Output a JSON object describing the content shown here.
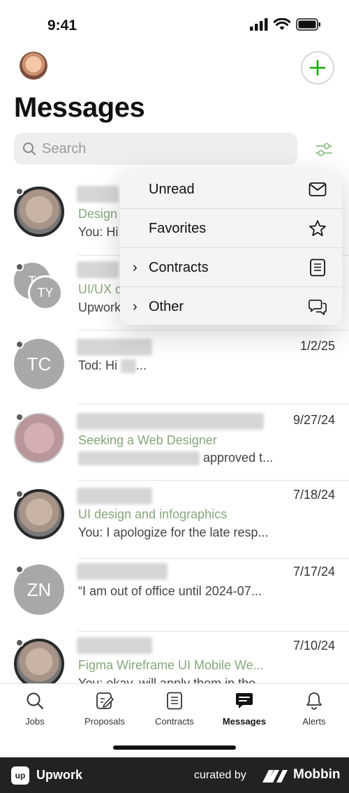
{
  "status": {
    "time": "9:41"
  },
  "header": {
    "title": "Messages"
  },
  "search": {
    "placeholder": "Search"
  },
  "dropdown": {
    "items": [
      {
        "label": "Unread",
        "icon": "envelope-icon"
      },
      {
        "label": "Favorites",
        "icon": "star-icon"
      },
      {
        "label": "Contracts",
        "icon": "document-icon"
      },
      {
        "label": "Other",
        "icon": "chat-bubbles-icon"
      }
    ]
  },
  "messages": [
    {
      "subject": "Design",
      "preview": "You: Hi"
    },
    {
      "initials_a": "T",
      "initials_b": "TY",
      "subject": "UI/UX d",
      "preview": "Upwork"
    },
    {
      "initials": "TC",
      "date": "1/2/25",
      "preview_prefix": "Tod: Hi",
      "preview_suffix": "..."
    },
    {
      "date": "9/27/24",
      "subject": "Seeking a Web Designer",
      "preview_suffix": "approved t..."
    },
    {
      "date": "7/18/24",
      "subject": "UI design and infographics",
      "preview": "You: I apologize for the late resp..."
    },
    {
      "initials": "ZN",
      "date": "7/17/24",
      "preview": "“I am out of office until 2024-07..."
    },
    {
      "date": "7/10/24",
      "subject": "Figma Wireframe UI Mobile We...",
      "preview": "You: okay, will apply them in the..."
    }
  ],
  "tabs": [
    {
      "label": "Jobs",
      "icon": "search-icon"
    },
    {
      "label": "Proposals",
      "icon": "proposal-icon"
    },
    {
      "label": "Contracts",
      "icon": "contract-icon"
    },
    {
      "label": "Messages",
      "icon": "message-icon"
    },
    {
      "label": "Alerts",
      "icon": "bell-icon"
    }
  ],
  "footer": {
    "logo": "up",
    "brand": "Upwork",
    "curated": "curated by",
    "mobbin": "Mobbin"
  },
  "colors": {
    "accent": "#14a800",
    "subject_green": "#86a77b"
  }
}
